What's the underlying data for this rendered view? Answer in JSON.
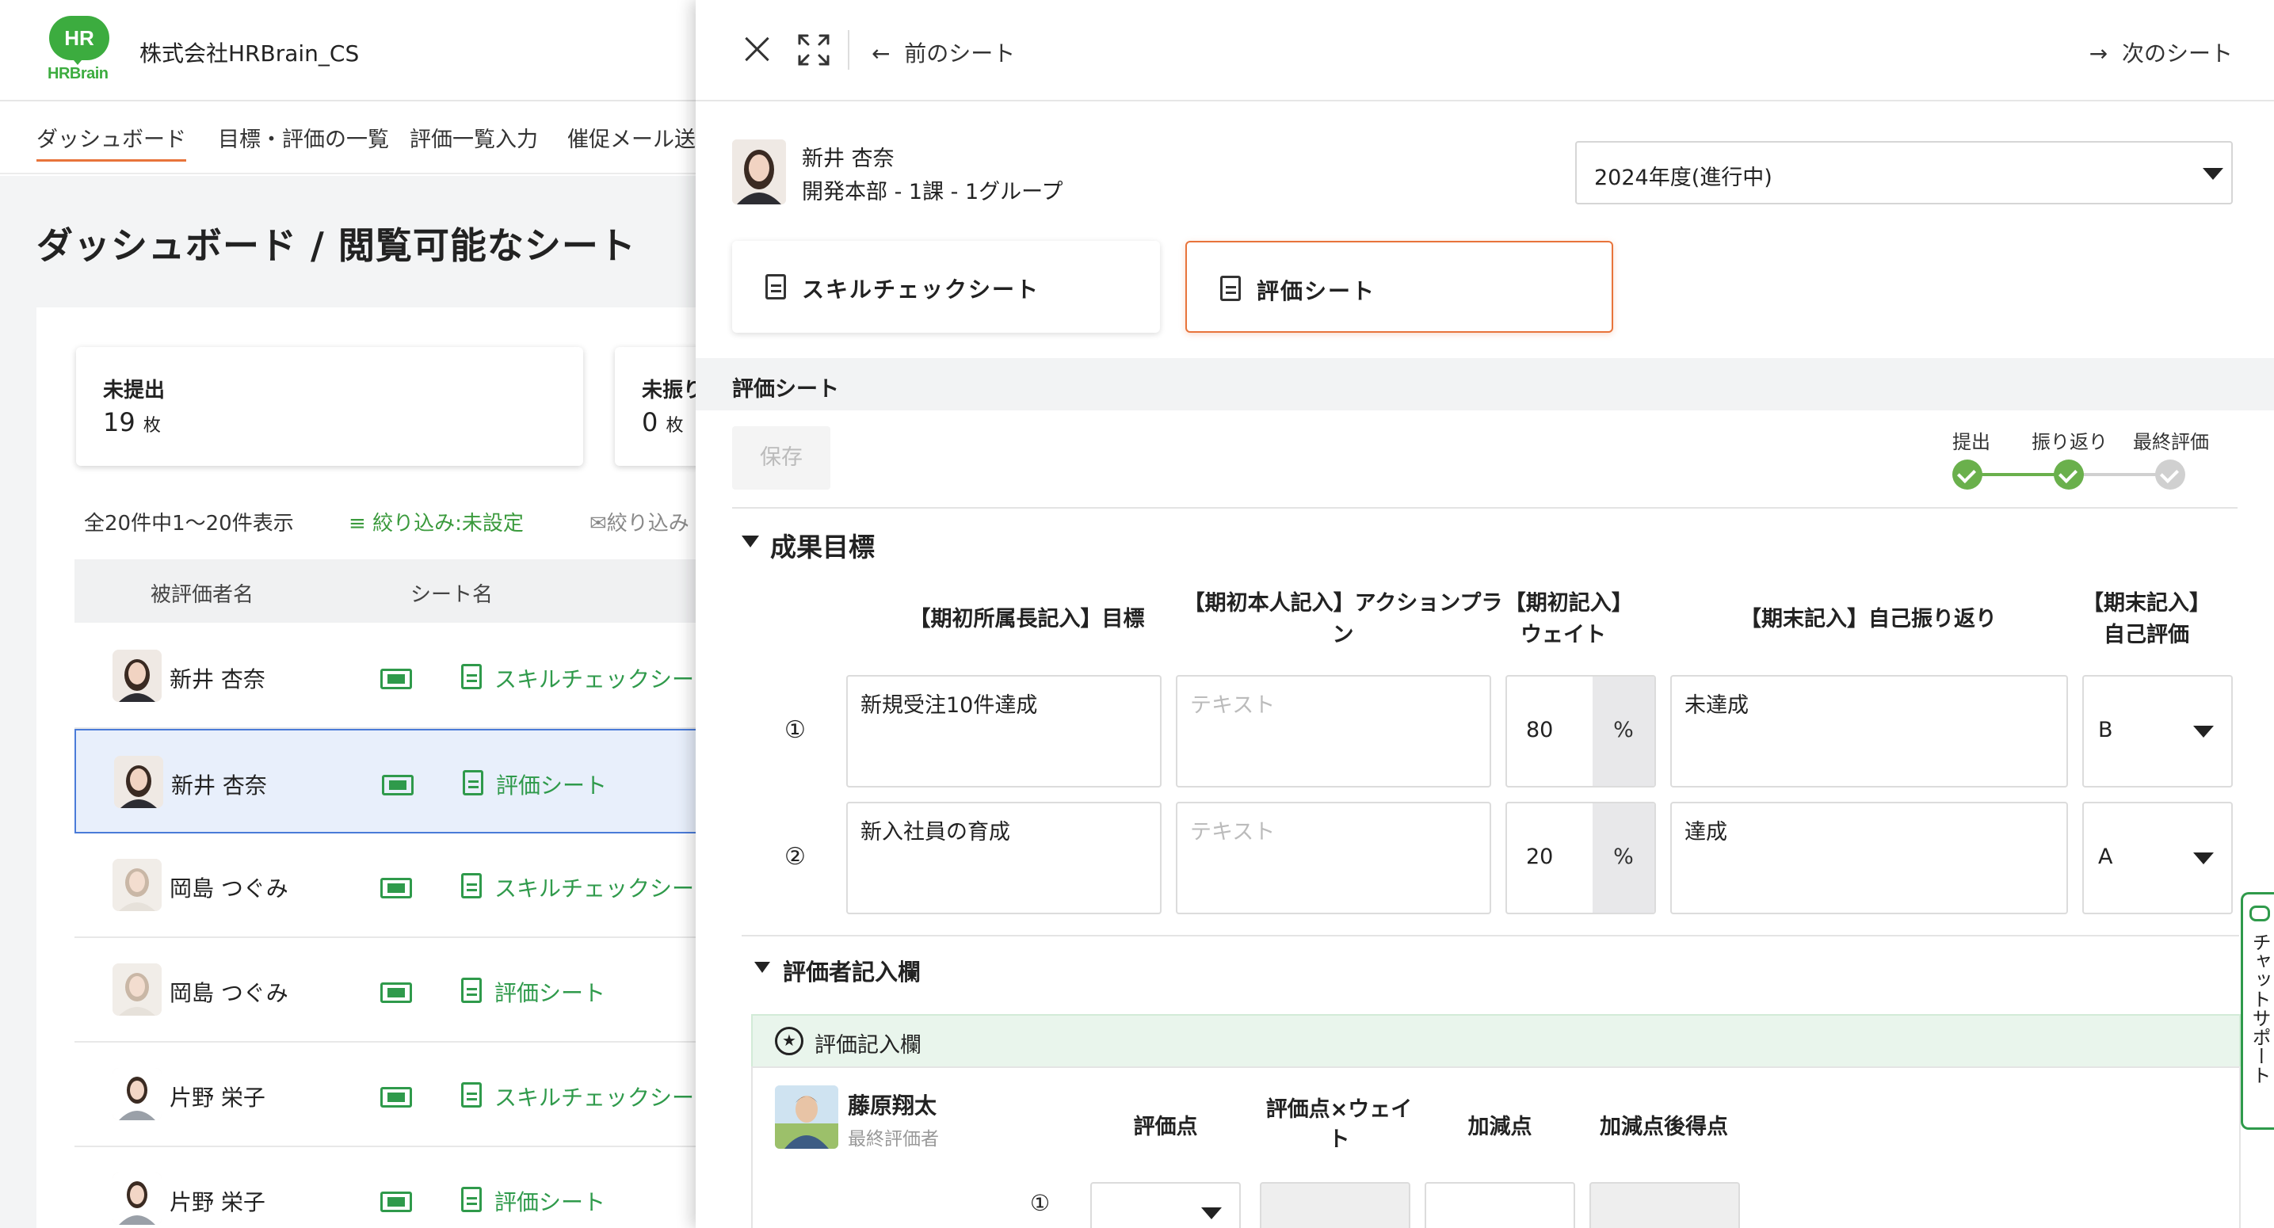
{
  "app": {
    "logo_text": "HR",
    "logo_subtext": "HRBrain",
    "company": "株式会社HRBrain_CS",
    "nav": [
      "ダッシュボード",
      "目標・評価の一覧",
      "評価一覧入力",
      "催促メール送"
    ],
    "page_title": "ダッシュボード / 閲覧可能なシート",
    "stats": [
      {
        "label": "未提出",
        "value": "19",
        "unit": "枚"
      },
      {
        "label": "未振り",
        "value": "0",
        "unit": "枚"
      }
    ],
    "list_meta": "全20件中1〜20件表示",
    "filter_label": "絞り込み:未設定",
    "filter_label2": "絞り込み",
    "columns": [
      "被評価者名",
      "シート名"
    ],
    "rows": [
      {
        "name": "新井 杏奈",
        "sheet": "スキルチェックシー"
      },
      {
        "name": "新井 杏奈",
        "sheet": "評価シート"
      },
      {
        "name": "岡島 つぐみ",
        "sheet": "スキルチェックシー"
      },
      {
        "name": "岡島 つぐみ",
        "sheet": "評価シート"
      },
      {
        "name": "片野 栄子",
        "sheet": "スキルチェックシー"
      },
      {
        "name": "片野 栄子",
        "sheet": "評価シート"
      }
    ]
  },
  "drawer": {
    "prev_label": "前のシート",
    "next_label": "次のシート",
    "employee": {
      "name": "新井 杏奈",
      "dept": "開発本部 - 1課 - 1グループ"
    },
    "period_select": "2024年度(進行中)",
    "tabs": [
      "スキルチェックシート",
      "評価シート"
    ],
    "active_tab": 1,
    "section_title": "評価シート",
    "save_label": "保存",
    "steps": [
      "提出",
      "振り返り",
      "最終評価"
    ],
    "goals": {
      "title": "成果目標",
      "headers": [
        "【期初所属長記入】目標",
        "【期初本人記入】アクションプラン",
        "【期初記入】ウェイト",
        "【期末記入】自己振り返り",
        "【期末記入】自己評価"
      ],
      "rows": [
        {
          "num": "①",
          "goal": "新規受注10件達成",
          "action": "テキスト",
          "weight": "80",
          "unit": "%",
          "reflection": "未達成",
          "self_eval": "B"
        },
        {
          "num": "②",
          "goal": "新入社員の育成",
          "action": "テキスト",
          "weight": "20",
          "unit": "%",
          "reflection": "達成",
          "self_eval": "A"
        }
      ]
    },
    "evaluator": {
      "section_title": "評価者記入欄",
      "bar_label": "評価記入欄",
      "name": "藤原翔太",
      "role": "最終評価者",
      "columns": [
        "評価点",
        "評価点×ウェイト",
        "加減点",
        "加減点後得点"
      ],
      "row_num": "①"
    },
    "chat_label": "チャットサポート"
  },
  "colors": {
    "accent": "#e8743b",
    "brand_green": "#3cac3f",
    "link_green": "#2f9a4b",
    "progress_green": "#6ab04c"
  }
}
